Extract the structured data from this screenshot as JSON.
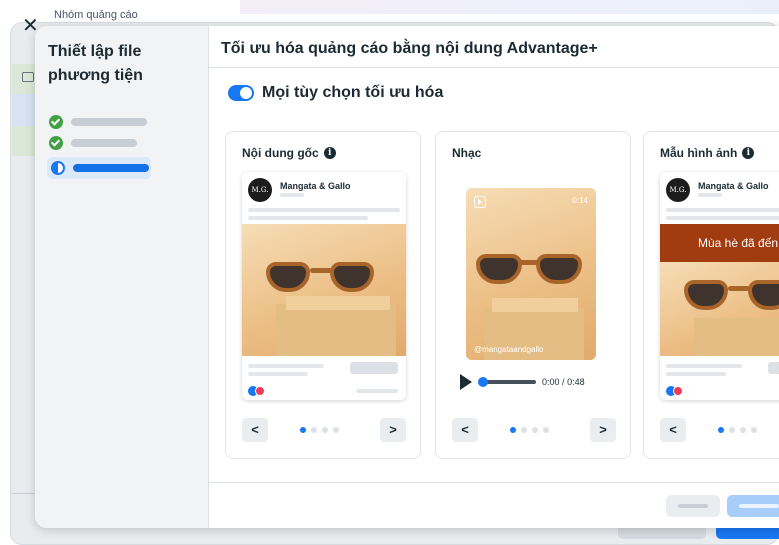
{
  "background": {
    "dialog_title": "Nhóm quảng cáo"
  },
  "sidebar": {
    "title": "Thiết lập file phương tiện",
    "steps": [
      {
        "status": "complete",
        "icon": "check-circle-icon"
      },
      {
        "status": "complete",
        "icon": "check-circle-icon"
      },
      {
        "status": "in-progress",
        "icon": "half-circle-icon"
      }
    ]
  },
  "header": {
    "title": "Tối ưu hóa quảng cáo bằng nội dung Advantage+"
  },
  "toggle": {
    "label": "Mọi tùy chọn tối ưu hóa",
    "on": true
  },
  "cards": [
    {
      "title": "Nội dung gốc",
      "has_info": true,
      "post": {
        "brand": "Mangata & Gallo",
        "avatar_text": "M.G."
      },
      "nav": {
        "prev": "<",
        "next": ">",
        "dots": 4,
        "active_dot": 0
      }
    },
    {
      "title": "Nhạc",
      "has_info": false,
      "video": {
        "duration_badge": "0:14",
        "handle": "@mangataandgallo"
      },
      "player": {
        "current": "0:00",
        "separator": "/",
        "total": "0:48",
        "progress": 0.0
      },
      "nav": {
        "prev": "<",
        "next": ">",
        "dots": 4,
        "active_dot": 0
      }
    },
    {
      "title": "Mẫu hình ảnh",
      "has_info": true,
      "post": {
        "brand": "Mangata & Gallo",
        "avatar_text": "M.G.",
        "banner": "Mùa hè đã đến"
      },
      "nav": {
        "prev": "<",
        "next": ">",
        "dots": 4,
        "active_dot": 0
      }
    }
  ],
  "colors": {
    "accent": "#1877f2",
    "success": "#42a045",
    "banner": "#a13b10"
  }
}
